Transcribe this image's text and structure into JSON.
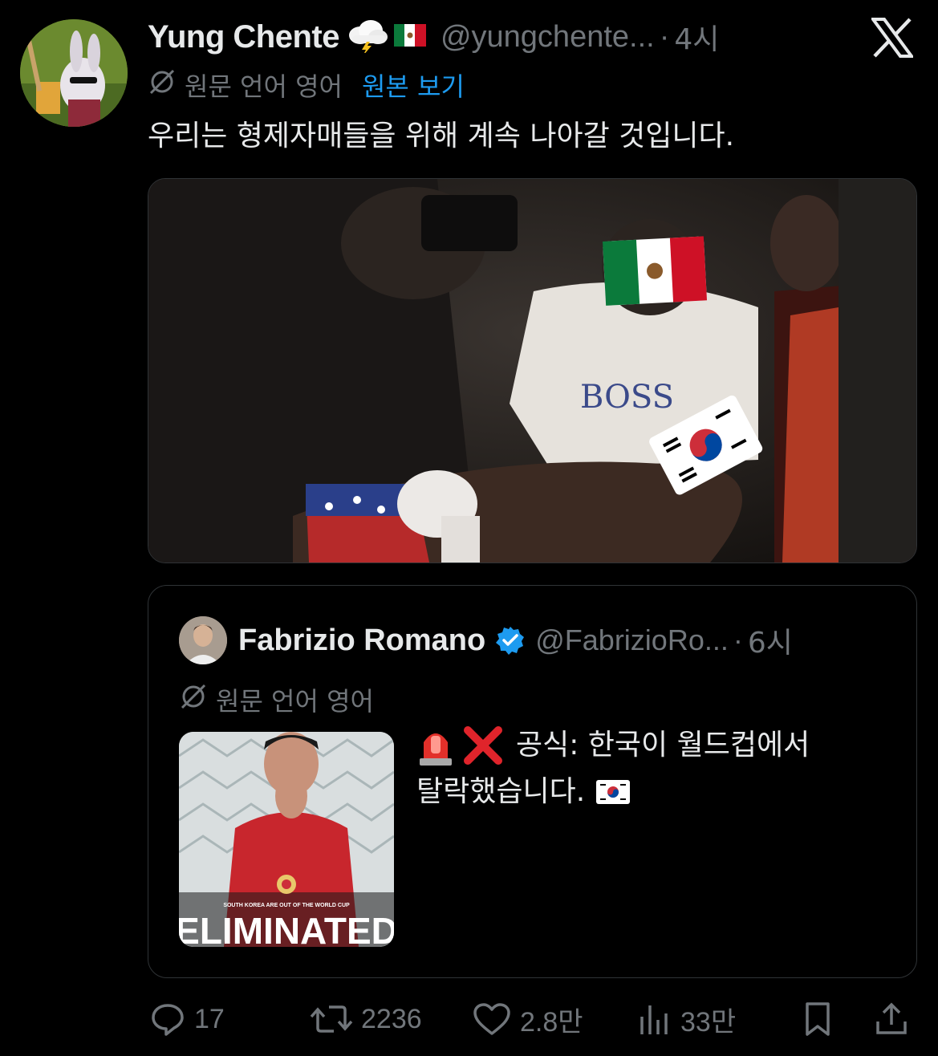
{
  "tweet": {
    "author_name": "Yung Chente",
    "author_emojis": [
      "cloud-lightning-icon",
      "mexico-flag-icon"
    ],
    "handle": "@yungchente...",
    "separator": "·",
    "time": "4시",
    "lang_note": "원문 언어 영어",
    "show_original": "원본 보기",
    "text": "우리는 형제자매들을 위해 계속 나아갈 것입니다.",
    "media_label": "BOSS"
  },
  "quote": {
    "author_name": "Fabrizio Romano",
    "handle": "@FabrizioRo...",
    "separator": "·",
    "time": "6시",
    "lang_note": "원문 언어 영어",
    "text_line1": "공식: 한국이 월드컵에서",
    "text_line2": "탈락했습니다.",
    "thumb_caption_small": "SOUTH KOREA ARE OUT OF THE WORLD CUP",
    "thumb_caption_big": "ELIMINATED"
  },
  "actions": {
    "replies": "17",
    "retweets": "2236",
    "likes": "2.8만",
    "views": "33만"
  },
  "colors": {
    "background": "#000000",
    "text_primary": "#e7e9ea",
    "text_secondary": "#71767b",
    "link": "#1d9bf0",
    "verified": "#1d9bf0",
    "border": "#2f3336"
  }
}
